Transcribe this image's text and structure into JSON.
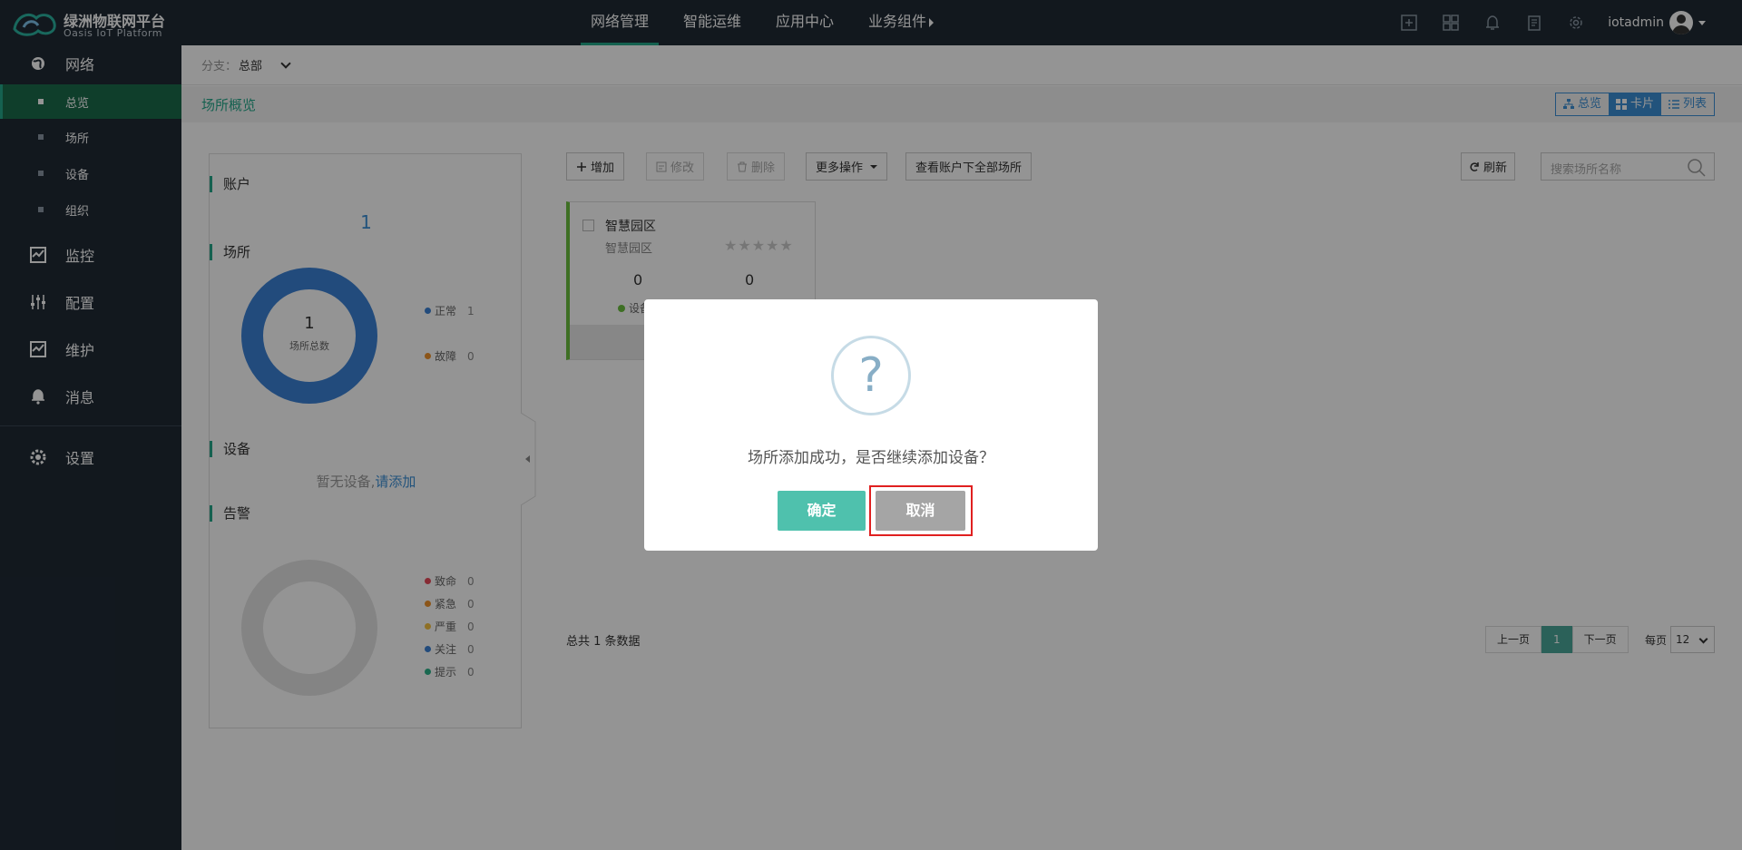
{
  "topbar": {
    "logo_name": "绿洲物联网平台",
    "logo_sub": "Oasis IoT Platform",
    "nav": [
      "网络管理",
      "智能运维",
      "应用中心",
      "业务组件"
    ],
    "active_nav": "网络管理",
    "username": "iotadmin"
  },
  "sidebar": {
    "groups": {
      "network": "网络",
      "monitor": "监控",
      "config": "配置",
      "maintain": "维护",
      "message": "消息",
      "settings": "设置"
    },
    "subitems": [
      "总览",
      "场所",
      "设备",
      "组织"
    ],
    "active_sub": "总览"
  },
  "branch": {
    "label": "分支：",
    "value": "总部"
  },
  "title": "场所概览",
  "view_tabs": [
    "总览",
    "卡片",
    "列表"
  ],
  "active_view": "卡片",
  "panel": {
    "account_title": "账户",
    "account_count": "1",
    "site_title": "场所",
    "site_total": "1",
    "site_total_label": "场所总数",
    "site_legend": [
      {
        "label": "正常",
        "value": "1",
        "color": "#3b82d6"
      },
      {
        "label": "故障",
        "value": "0",
        "color": "#f0932b"
      }
    ],
    "device_title": "设备",
    "device_empty": "暂无设备,",
    "device_add_link": "请添加",
    "alarm_title": "告警",
    "alarm_legend": [
      {
        "label": "致命",
        "value": "0",
        "color": "#e94b5b"
      },
      {
        "label": "紧急",
        "value": "0",
        "color": "#f0932b"
      },
      {
        "label": "严重",
        "value": "0",
        "color": "#f5c242"
      },
      {
        "label": "关注",
        "value": "0",
        "color": "#3b82d6"
      },
      {
        "label": "提示",
        "value": "0",
        "color": "#2bb38a"
      }
    ]
  },
  "toolbar": {
    "add": "增加",
    "edit": "修改",
    "delete": "删除",
    "more": "更多操作",
    "view_all": "查看账户下全部场所",
    "refresh": "刷新",
    "search_placeholder": "搜索场所名称"
  },
  "card": {
    "name": "智慧园区",
    "subname": "智慧园区",
    "stat1": "0",
    "stat2": "0",
    "device_label": "设备"
  },
  "footer": {
    "total": "总共 1 条数据",
    "prev": "上一页",
    "page": "1",
    "next": "下一页",
    "per_page_label": "每页",
    "per_page_value": "12"
  },
  "modal": {
    "icon": "?",
    "message": "场所添加成功，是否继续添加设备？",
    "ok": "确定",
    "cancel": "取消"
  }
}
